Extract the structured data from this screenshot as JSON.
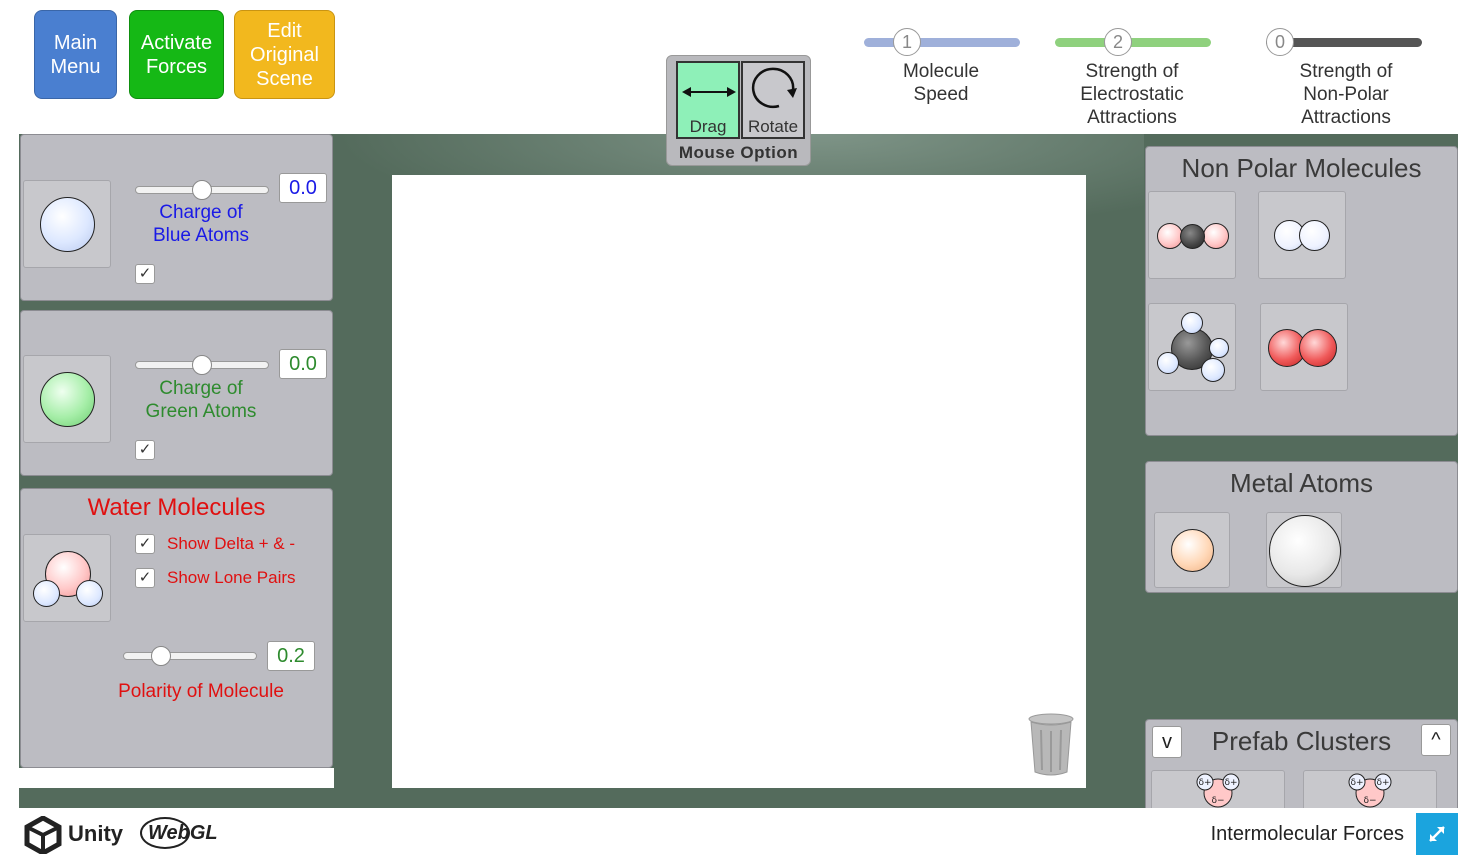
{
  "top_buttons": {
    "main_menu": "Main\nMenu",
    "activate_forces": "Activate\nForces",
    "edit_scene": "Edit\nOriginal\nScene"
  },
  "mouse_option": {
    "drag": "Drag",
    "rotate": "Rotate",
    "title": "Mouse Option"
  },
  "top_sliders": [
    {
      "value": "1",
      "label": "Molecule\nSpeed",
      "color": "#9fb0da"
    },
    {
      "value": "2",
      "label": "Strength of\nElectrostatic\nAttractions",
      "color": "#8fd17e"
    },
    {
      "value": "0",
      "label": "Strength of\nNon-Polar\nAttractions",
      "color": "#555555"
    }
  ],
  "blue_panel": {
    "value": "0.0",
    "label": "Charge of\nBlue Atoms",
    "checked": "✓",
    "slider_level": 0.5,
    "color": "#1a1ae6"
  },
  "green_panel": {
    "value": "0.0",
    "label": "Charge of\nGreen Atoms",
    "checked": "✓",
    "slider_level": 0.5,
    "color": "#2e8b2e"
  },
  "water_panel": {
    "title": "Water Molecules",
    "show_delta": "Show Delta + & -",
    "show_lone_pairs": "Show Lone Pairs",
    "checked": "✓",
    "value": "0.2",
    "polarity_label": "Polarity of Molecule",
    "slider_level": 0.2,
    "color": "#e01010"
  },
  "non_polar": {
    "title": "Non Polar Molecules"
  },
  "metal": {
    "title": "Metal Atoms"
  },
  "prefab": {
    "title": "Prefab Clusters",
    "down": "v",
    "up": "^"
  },
  "footer": {
    "unity": "Unity",
    "webgl": "WebGL",
    "title": "Intermolecular Forces"
  }
}
